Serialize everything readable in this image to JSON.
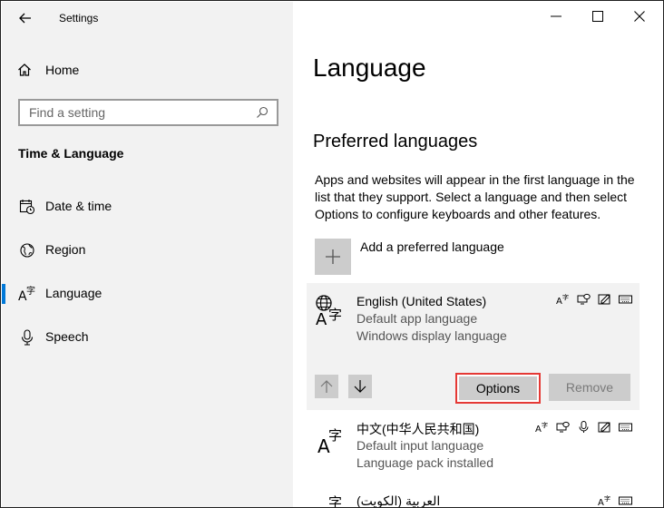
{
  "window": {
    "title": "Settings"
  },
  "sidebar": {
    "home_label": "Home",
    "search_placeholder": "Find a setting",
    "section_title": "Time & Language",
    "items": [
      {
        "label": "Date & time",
        "icon": "calendar-clock-icon"
      },
      {
        "label": "Region",
        "icon": "globe-icon"
      },
      {
        "label": "Language",
        "icon": "language-icon",
        "selected": true
      },
      {
        "label": "Speech",
        "icon": "microphone-icon"
      }
    ]
  },
  "main": {
    "title": "Language",
    "section_title": "Preferred languages",
    "description": "Apps and websites will appear in the first language in the list that they support. Select a language and then select Options to configure keyboards and other features.",
    "add_label": "Add a preferred language",
    "languages": [
      {
        "name": "English (United States)",
        "lines": [
          "Default app language",
          "Windows display language"
        ],
        "features": [
          "display-language-icon",
          "speech-icon",
          "handwriting-icon",
          "keyboard-icon"
        ]
      },
      {
        "name": "中文(中华人民共和国)",
        "lines": [
          "Default input language",
          "Language pack installed"
        ],
        "features": [
          "display-language-icon",
          "speech-icon",
          "microphone-icon",
          "handwriting-icon",
          "keyboard-icon"
        ]
      },
      {
        "name": "العربية (الكويت)",
        "lines": [],
        "features": [
          "display-language-icon",
          "keyboard-icon"
        ]
      }
    ],
    "options_label": "Options",
    "remove_label": "Remove"
  },
  "colors": {
    "accent": "#0078d7",
    "highlight": "#e53935",
    "sidebar_bg": "#f2f2f2",
    "button_bg": "#cccccc"
  }
}
